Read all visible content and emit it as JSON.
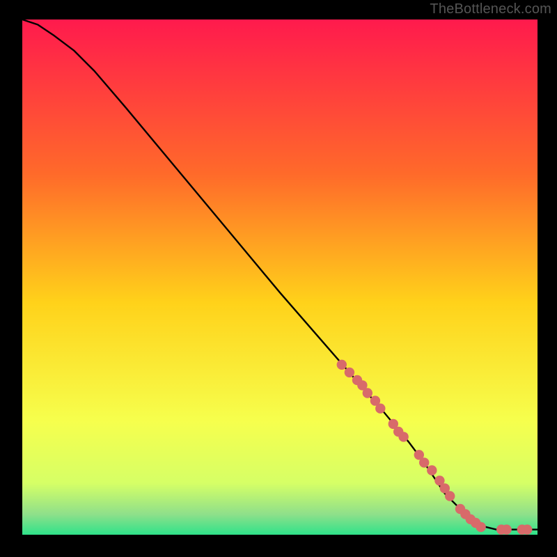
{
  "watermark": "TheBottleneck.com",
  "colors": {
    "page_bg": "#000000",
    "grad_top": "#ff1a4d",
    "grad_mid1": "#ff7a2a",
    "grad_mid2": "#ffd21a",
    "grad_mid3": "#f6ff4d",
    "grad_mid4": "#d6ff66",
    "grad_bottom": "#2fe28a",
    "line": "#000000",
    "marker_fill": "#d86a6a",
    "marker_stroke": "#b94d4d",
    "watermark": "#555555"
  },
  "chart_data": {
    "type": "line",
    "title": "",
    "xlabel": "",
    "ylabel": "",
    "xlim": [
      0,
      100
    ],
    "ylim": [
      0,
      100
    ],
    "series": [
      {
        "name": "curve",
        "x": [
          0,
          3,
          6,
          10,
          14,
          20,
          30,
          40,
          50,
          60,
          70,
          75,
          78,
          80,
          82,
          85,
          88,
          90,
          92,
          95,
          98,
          100
        ],
        "y": [
          100,
          99,
          97,
          94,
          90,
          83,
          71,
          59,
          47,
          35.5,
          24,
          18,
          14,
          11,
          8,
          5,
          2.5,
          1.5,
          1,
          1,
          1,
          1
        ]
      }
    ],
    "markers": {
      "name": "highlight-points",
      "x": [
        62,
        63.5,
        65,
        66,
        67,
        68.5,
        69.5,
        72,
        73,
        74,
        77,
        78,
        79.5,
        81,
        82,
        83,
        85,
        86,
        87,
        88,
        89,
        93,
        94,
        97,
        98
      ],
      "y": [
        33,
        31.5,
        30,
        29,
        27.5,
        26,
        24.5,
        21.5,
        20,
        19,
        15.5,
        14,
        12.5,
        10.5,
        9,
        7.5,
        5,
        4,
        3,
        2.3,
        1.5,
        1,
        1,
        1,
        1
      ]
    },
    "gradient_stops": [
      {
        "offset": 0.0,
        "color": "#ff1a4d"
      },
      {
        "offset": 0.3,
        "color": "#ff6a2a"
      },
      {
        "offset": 0.55,
        "color": "#ffd21a"
      },
      {
        "offset": 0.78,
        "color": "#f6ff4d"
      },
      {
        "offset": 0.9,
        "color": "#d6ff66"
      },
      {
        "offset": 0.96,
        "color": "#8fe08a"
      },
      {
        "offset": 1.0,
        "color": "#2fe28a"
      }
    ]
  }
}
